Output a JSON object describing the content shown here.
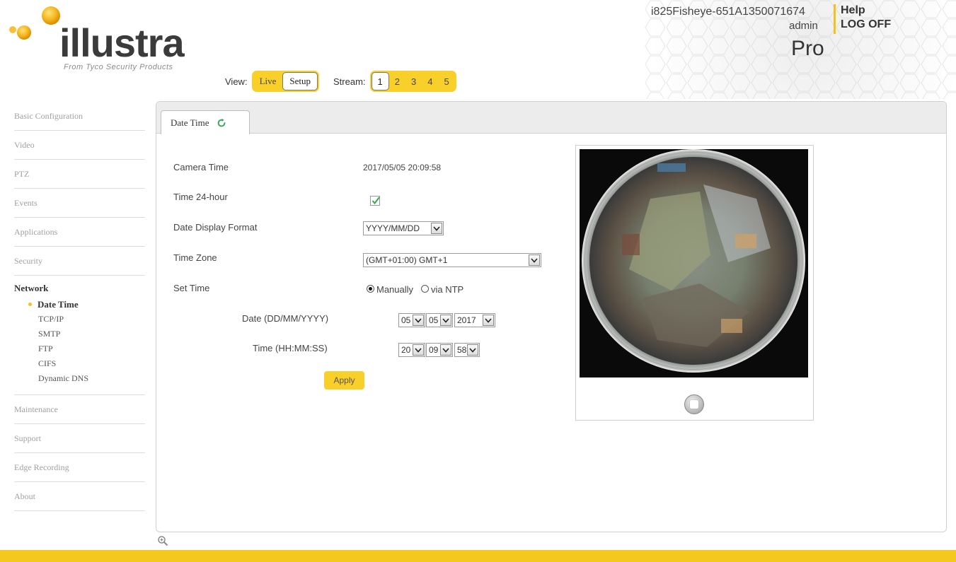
{
  "brand": {
    "name": "illustra",
    "tagline": "From Tyco Security Products"
  },
  "header": {
    "camera_name": "i825Fisheye-651A1350071674",
    "user": "admin",
    "help_label": "Help",
    "logoff_label": "LOG OFF",
    "edition": "Pro",
    "accent_color": "#f9cf2a"
  },
  "view": {
    "label": "View:",
    "options": [
      "Live",
      "Setup"
    ],
    "selected": "Setup"
  },
  "stream": {
    "label": "Stream:",
    "options": [
      "1",
      "2",
      "3",
      "4",
      "5"
    ],
    "selected": "1"
  },
  "sidebar": {
    "top_items": [
      "Basic Configuration",
      "Video",
      "PTZ",
      "Events",
      "Applications",
      "Security"
    ],
    "group": {
      "title": "Network",
      "items": [
        "Date Time",
        "TCP/IP",
        "SMTP",
        "FTP",
        "CIFS",
        "Dynamic DNS"
      ],
      "active": "Date Time"
    },
    "bottom_items": [
      "Maintenance",
      "Support",
      "Edge Recording",
      "About"
    ]
  },
  "tab": {
    "label": "Date Time",
    "icon": "refresh-icon"
  },
  "form": {
    "camera_time_label": "Camera Time",
    "camera_time_value": "2017/05/05 20:09:58",
    "time24_label": "Time 24-hour",
    "time24_checked": true,
    "date_format_label": "Date Display Format",
    "date_format_value": "YYYY/MM/DD",
    "timezone_label": "Time Zone",
    "timezone_value": "(GMT+01:00) GMT+1",
    "set_time_label": "Set Time",
    "set_time_manual": "Manually",
    "set_time_ntp": "via NTP",
    "set_time_selected": "Manually",
    "date_label": "Date (DD/MM/YYYY)",
    "date_day": "05",
    "date_month": "05",
    "date_year": "2017",
    "time_label": "Time (HH:MM:SS)",
    "time_hour": "20",
    "time_min": "09",
    "time_sec": "58",
    "apply_label": "Apply"
  }
}
